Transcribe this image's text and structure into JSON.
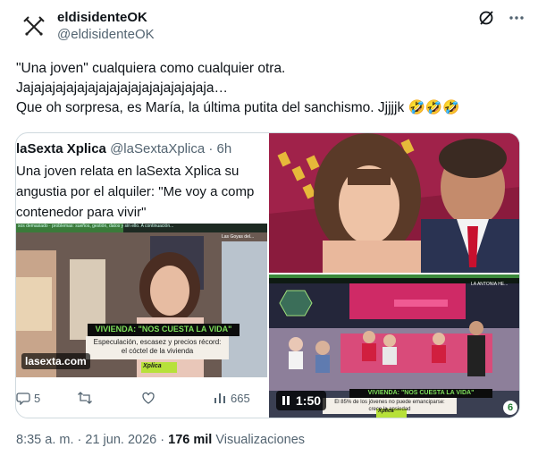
{
  "author": {
    "display_name": "eldisidenteOK",
    "handle": "@eldisidenteOK",
    "avatar_icon": "crossed-swords-icon"
  },
  "header_icons": [
    "grok-slash-icon",
    "more-dots-icon"
  ],
  "tweet": {
    "lines": [
      "\"Una joven\" cualquiera como cualquier otra.",
      "Jajajajajajajajajajajajajajajajajaja…",
      "Que oh sorpresa, es María, la última putita del sanchismo. Jjjjjk 🤣🤣🤣"
    ]
  },
  "quote": {
    "name": "laSexta Xplica",
    "handle": "@laSextaXplica",
    "separator": "·",
    "time": "6h",
    "text_lines": [
      "Una joven relata en laSexta Xplica su",
      "angustia por el alquiler: \"Me voy a comp",
      "contenedor para vivir\""
    ],
    "media": {
      "ticker_text": "sos demasiado · problemas: sueños, gestión, datos y sin ello. A continuación...",
      "banner_title": "VIVIENDA: \"NOS CUESTA LA VIDA\"",
      "banner_sub_1": "Especulación, escasez y precios récord:",
      "banner_sub_2": "el cóctel de la vivienda",
      "brand": "lasexta.com",
      "tag": "Xplica",
      "corner_text": "Las Goyas del..."
    },
    "actions": {
      "replies": "5",
      "retweets": "",
      "likes": "",
      "views": "665"
    }
  },
  "video": {
    "banner_title": "VIVIENDA: \"NOS CUESTA LA VIDA\"",
    "banner_sub_1": "El 85% de los jóvenes no puede emanciparse:",
    "banner_sub_2": "crece la ansiedad",
    "top_text": "LA ANTONIA HE...",
    "tag": "Xplica",
    "duration": "1:50",
    "channel": "6"
  },
  "footer": {
    "time": "8:35 a. m.",
    "separator": "·",
    "date": "21 jun. 2026",
    "separator2": "·",
    "views_count": "176 mil",
    "views_label": "Visualizaciones"
  },
  "colors": {
    "text": "#0f1419",
    "muted": "#536471",
    "border": "#cfd9de",
    "banner_green": "#6fd44a",
    "studio_magenta": "#d3246a"
  }
}
